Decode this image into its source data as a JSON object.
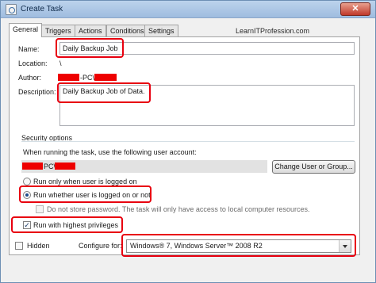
{
  "window": {
    "title": "Create Task",
    "close_label": "✕"
  },
  "tabs": [
    {
      "label": "General",
      "active": true
    },
    {
      "label": "Triggers",
      "active": false
    },
    {
      "label": "Actions",
      "active": false
    },
    {
      "label": "Conditions",
      "active": false
    },
    {
      "label": "Settings",
      "active": false
    }
  ],
  "watermark": "LearnITProfession.com",
  "general": {
    "name_label": "Name:",
    "name_value": "Daily Backup Job",
    "location_label": "Location:",
    "location_value": "\\",
    "author_label": "Author:",
    "author_value": "-PC\\",
    "description_label": "Description:",
    "description_value": "Daily Backup Job of Data."
  },
  "security": {
    "group_title": "Security options",
    "account_prompt": "When running the task, use the following user account:",
    "account_value": "PC\\",
    "change_user_button": "Change User or Group...",
    "run_logged_on": "Run only when user is logged on",
    "run_whether": "Run whether user is logged on or not",
    "run_whether_selected": true,
    "dont_store_password": "Do not store password.  The task will only have access to local computer resources.",
    "dont_store_password_checked": false,
    "highest_privileges": "Run with highest privileges",
    "highest_privileges_checked": true
  },
  "bottom": {
    "hidden_label": "Hidden",
    "hidden_checked": false,
    "configure_label": "Configure for:",
    "configure_value": "Windows® 7, Windows Server™ 2008 R2"
  },
  "colors": {
    "highlight": "#e8000f",
    "redaction": "#ee0000"
  }
}
